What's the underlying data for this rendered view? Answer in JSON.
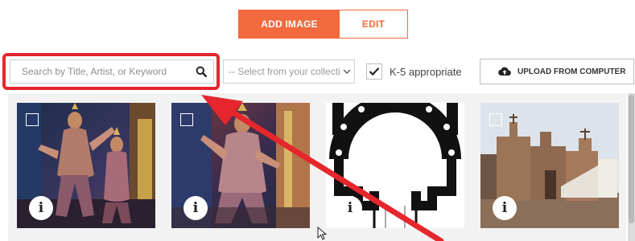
{
  "tabs": {
    "add_image": "ADD IMAGE",
    "edit": "EDIT"
  },
  "search": {
    "placeholder": "Search by Title, Artist, or Keyword",
    "icon": "search-icon"
  },
  "collection_select": {
    "selected": "-- Select from your collecti"
  },
  "k5_filter": {
    "label": "K-5 appropriate",
    "checked": true
  },
  "upload": {
    "label": "UPLOAD FROM COMPUTER",
    "icon": "cloud-upload-icon"
  },
  "gallery": {
    "info_glyph": "i",
    "images": [
      {
        "subject": "dancers-in-ornate-costume"
      },
      {
        "subject": "dancer-close-up"
      },
      {
        "subject": "architectural-floor-plan"
      },
      {
        "subject": "adobe-church"
      }
    ]
  },
  "colors": {
    "accent": "#f26a3d",
    "highlight": "#e5262d"
  }
}
